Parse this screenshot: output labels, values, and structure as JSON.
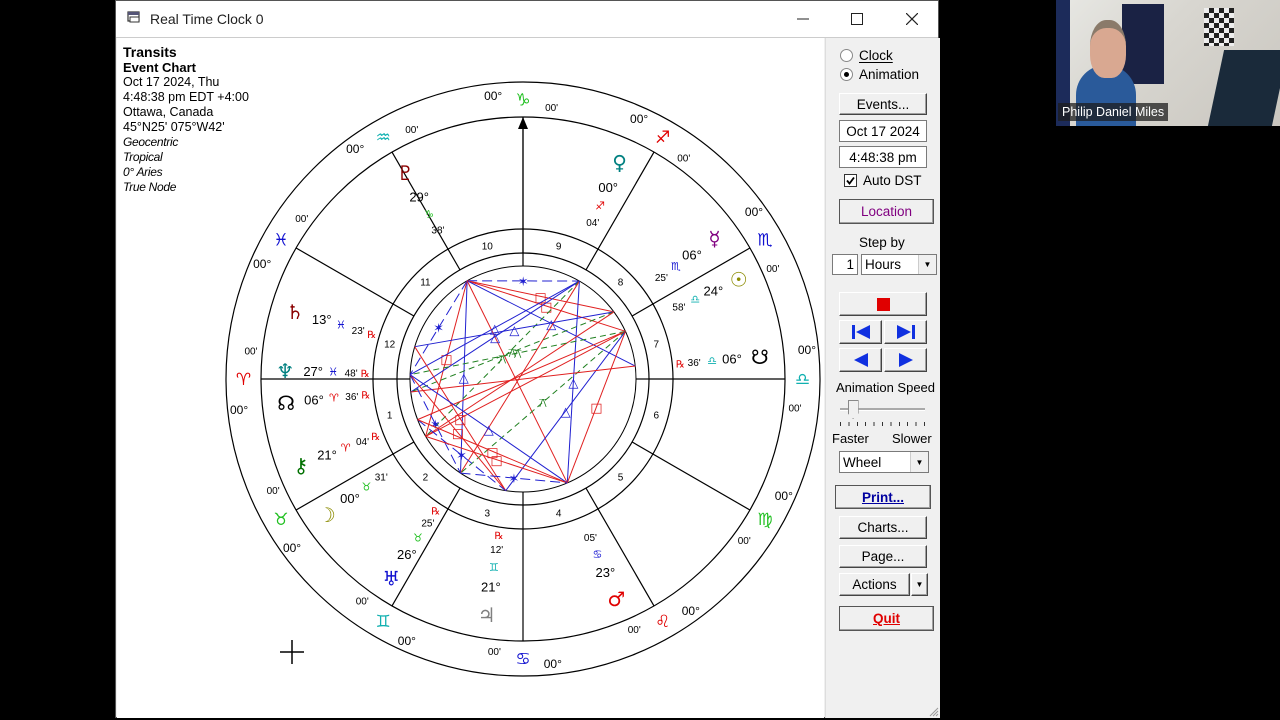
{
  "window": {
    "title": "Real Time Clock 0",
    "controls": {
      "minimize": "—",
      "maximize": "☐",
      "close": "✕"
    }
  },
  "chart_info": {
    "line1": "Transits",
    "line2": "Event Chart",
    "date": "Oct 17 2024, Thu",
    "time": "4:48:38 pm  EDT +4:00",
    "place": "Ottawa, Canada",
    "coords": "45°N25' 075°W42'",
    "settings": [
      "Geocentric",
      "Tropical",
      "0° Aries",
      "True Node"
    ]
  },
  "wheel": {
    "sign_cusps": [
      {
        "sign": "Aries",
        "glyph": "♈",
        "deg": "00°",
        "min": "00'",
        "color": "#e00000"
      },
      {
        "sign": "Taurus",
        "glyph": "♉",
        "deg": "00°",
        "min": "00'",
        "color": "#22c022"
      },
      {
        "sign": "Gemini",
        "glyph": "♊",
        "deg": "00°",
        "min": "00'",
        "color": "#10b0b0"
      },
      {
        "sign": "Cancer",
        "glyph": "♋",
        "deg": "00°",
        "min": "00'",
        "color": "#1010d0"
      },
      {
        "sign": "Leo",
        "glyph": "♌",
        "deg": "00°",
        "min": "00'",
        "color": "#e00000"
      },
      {
        "sign": "Virgo",
        "glyph": "♍",
        "deg": "00°",
        "min": "00'",
        "color": "#22c022"
      },
      {
        "sign": "Libra",
        "glyph": "♎",
        "deg": "00°",
        "min": "00'",
        "color": "#10b0b0"
      },
      {
        "sign": "Scorpio",
        "glyph": "♏",
        "deg": "00°",
        "min": "00'",
        "color": "#1010d0"
      },
      {
        "sign": "Sagittarius",
        "glyph": "♐",
        "deg": "00°",
        "min": "00'",
        "color": "#e00000"
      },
      {
        "sign": "Capricorn",
        "glyph": "♑",
        "deg": "00°",
        "min": "00'",
        "color": "#22c022"
      },
      {
        "sign": "Aquarius",
        "glyph": "♒",
        "deg": "00°",
        "min": "00'",
        "color": "#10b0b0"
      },
      {
        "sign": "Pisces",
        "glyph": "♓",
        "deg": "00°",
        "min": "00'",
        "color": "#1010d0"
      }
    ],
    "house_numbers": [
      "1",
      "2",
      "3",
      "4",
      "5",
      "6",
      "7",
      "8",
      "9",
      "10",
      "11",
      "12"
    ],
    "planets": [
      {
        "name": "Pluto",
        "glyph": "♇",
        "color": "#8b0000",
        "deg": "29°",
        "sign_glyph": "♑",
        "sign_color": "#22c022",
        "min": "38'",
        "retro": ""
      },
      {
        "name": "Venus",
        "glyph": "♀",
        "color": "#008080",
        "deg": "00°",
        "sign_glyph": "♐",
        "sign_color": "#e00000",
        "min": "04'",
        "retro": ""
      },
      {
        "name": "Mercury",
        "glyph": "☿",
        "color": "#800080",
        "deg": "06°",
        "sign_glyph": "♏",
        "sign_color": "#1010d0",
        "min": "25'",
        "retro": ""
      },
      {
        "name": "Sun",
        "glyph": "☉",
        "color": "#8b8b00",
        "deg": "24°",
        "sign_glyph": "♎",
        "sign_color": "#10b0b0",
        "min": "58'",
        "retro": ""
      },
      {
        "name": "South Node",
        "glyph": "☋",
        "color": "#000000",
        "deg": "06°",
        "sign_glyph": "♎",
        "sign_color": "#10b0b0",
        "min": "36'",
        "retro": "℞"
      },
      {
        "name": "Saturn",
        "glyph": "♄",
        "color": "#8b0000",
        "deg": "13°",
        "sign_glyph": "♓",
        "sign_color": "#1010d0",
        "min": "23'",
        "retro": "℞"
      },
      {
        "name": "Neptune",
        "glyph": "♆",
        "color": "#008080",
        "deg": "27°",
        "sign_glyph": "♓",
        "sign_color": "#1010d0",
        "min": "48'",
        "retro": "℞"
      },
      {
        "name": "North Node",
        "glyph": "☊",
        "color": "#000000",
        "deg": "06°",
        "sign_glyph": "♈",
        "sign_color": "#e00000",
        "min": "36'",
        "retro": "℞"
      },
      {
        "name": "Chiron",
        "glyph": "⚷",
        "color": "#007000",
        "deg": "21°",
        "sign_glyph": "♈",
        "sign_color": "#e00000",
        "min": "04'",
        "retro": "℞"
      },
      {
        "name": "Moon",
        "glyph": "☽",
        "color": "#8b8b00",
        "deg": "00°",
        "sign_glyph": "♉",
        "sign_color": "#22c022",
        "min": "31'",
        "retro": ""
      },
      {
        "name": "Uranus",
        "glyph": "♅",
        "color": "#1010d0",
        "deg": "26°",
        "sign_glyph": "♉",
        "sign_color": "#22c022",
        "min": "25'",
        "retro": "℞"
      },
      {
        "name": "Jupiter",
        "glyph": "♃",
        "color": "#808080",
        "deg": "21°",
        "sign_glyph": "♊",
        "sign_color": "#10b0b0",
        "min": "12'",
        "retro": "℞"
      },
      {
        "name": "Mars",
        "glyph": "♂",
        "color": "#e00000",
        "deg": "23°",
        "sign_glyph": "♋",
        "sign_color": "#1010d0",
        "min": "05'",
        "retro": ""
      }
    ],
    "aspect_colors": {
      "hard": "#e02020",
      "soft": "#2020d0",
      "minor": "#208020"
    }
  },
  "panel": {
    "mode_options": [
      {
        "label": "Clock",
        "selected": false
      },
      {
        "label": "Animation",
        "selected": true
      }
    ],
    "events_button": "Events...",
    "date_field": "Oct 17 2024",
    "time_field": "4:48:38 pm",
    "auto_dst_label": "Auto DST",
    "auto_dst_checked": true,
    "location_button": "Location",
    "step_by_label": "Step by",
    "step_value": "1",
    "step_unit": "Hours",
    "animation_speed_label": "Animation Speed",
    "speed_faster": "Faster",
    "speed_slower": "Slower",
    "speed_value_fraction": 0.1,
    "view_select": "Wheel",
    "print_button": "Print...",
    "charts_button": "Charts...",
    "page_button": "Page...",
    "actions_button": "Actions",
    "quit_button": "Quit"
  },
  "webcam": {
    "participant_name": "Philip Daniel Miles"
  }
}
